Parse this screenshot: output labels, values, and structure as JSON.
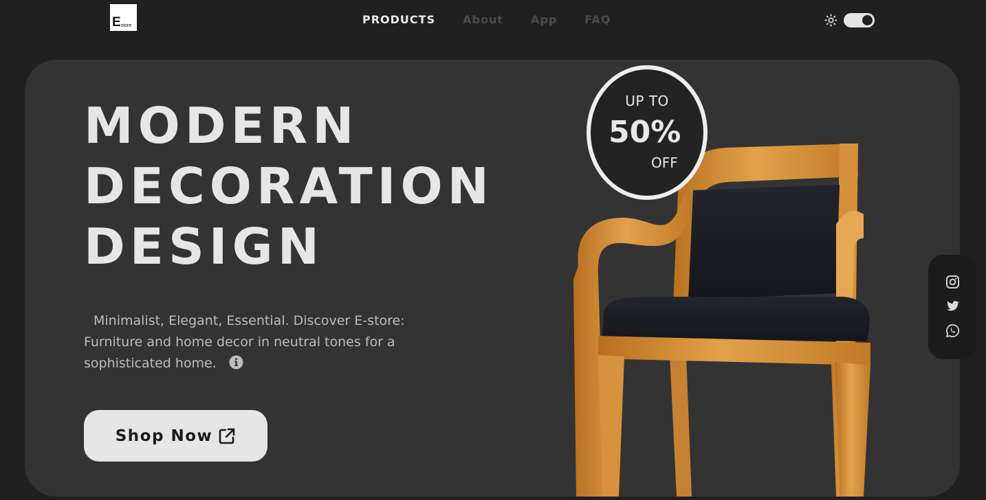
{
  "header": {
    "logo": {
      "letter": "E",
      "small": "store"
    },
    "nav": [
      {
        "label": "PRODUCTS",
        "active": true
      },
      {
        "label": "About",
        "active": false
      },
      {
        "label": "App",
        "active": false
      },
      {
        "label": "FAQ",
        "active": false
      }
    ],
    "theme_toggle": {
      "icon": "sun-icon",
      "state": "dark"
    }
  },
  "hero": {
    "headline": [
      "MODERN",
      "DECORATION",
      "DESIGN"
    ],
    "subtitle": "Minimalist, Elegant, Essential. Discover E-store: Furniture and home decor in neutral tones for a sophisticated home.",
    "info_icon": "info-circle-icon",
    "cta": {
      "label": "Shop Now",
      "icon": "external-link-icon"
    },
    "badge": {
      "line1": "UP TO",
      "line2": "50%",
      "line3": "OFF"
    },
    "image": "wooden-armchair-black-upholstery"
  },
  "social": [
    {
      "name": "instagram-icon"
    },
    {
      "name": "twitter-icon"
    },
    {
      "name": "whatsapp-icon"
    }
  ],
  "colors": {
    "page_bg": "#202020",
    "card_bg": "#333333",
    "text_primary": "#e6e6e6",
    "text_muted": "#bdbdbd",
    "nav_inactive": "#4b4b4b",
    "wood": "#d28a2c",
    "upholstery": "#1a1c22"
  }
}
